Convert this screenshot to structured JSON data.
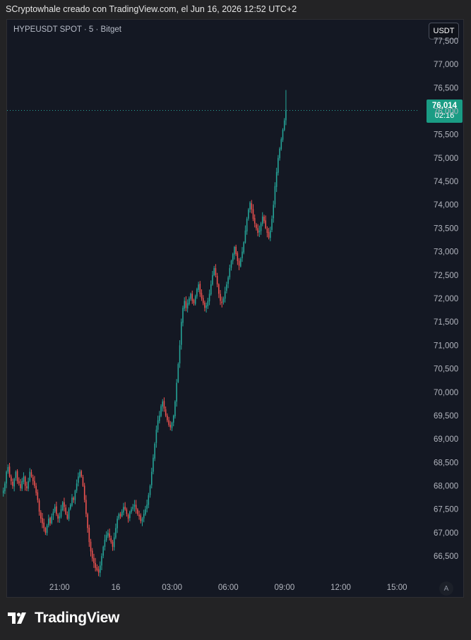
{
  "header": {
    "text": "SCryptowhale creado con TradingView.com, el Jun 16, 2026 12:52 UTC+2"
  },
  "legend": {
    "symbol": "HYPEUSDT SPOT · 5 · Bitget"
  },
  "currency_button": "USDT",
  "auto_button": "A",
  "last_price": {
    "price": "76,014",
    "countdown": "02:16"
  },
  "footer": {
    "logo_text": "TradingView"
  },
  "colors": {
    "up": "#26a69a",
    "down": "#ef5350",
    "background": "#141823",
    "price_tag": "#1a9c84"
  },
  "chart_data": {
    "type": "candlestick",
    "y_axis": {
      "position": "right",
      "ticks": [
        66500,
        67000,
        67500,
        68000,
        68500,
        69000,
        69500,
        70000,
        70500,
        71000,
        71500,
        72000,
        72500,
        73000,
        73500,
        74000,
        74500,
        75000,
        75500,
        76000,
        76500,
        77000,
        77500
      ],
      "tick_labels": [
        "66,500",
        "67,000",
        "67,500",
        "68,000",
        "68,500",
        "69,000",
        "69,500",
        "70,000",
        "70,500",
        "71,000",
        "71,500",
        "72,000",
        "72,500",
        "73,000",
        "73,500",
        "74,000",
        "74,500",
        "75,000",
        "75,500",
        "76,000",
        "76,500",
        "77,000",
        "77,500"
      ],
      "ylim": [
        66050,
        77950
      ]
    },
    "x_axis": {
      "ticks": [
        "21:00",
        "16",
        "03:00",
        "06:00",
        "09:00",
        "12:00",
        "15:00"
      ],
      "tick_hours": [
        21,
        24,
        27,
        30,
        33,
        36,
        39
      ],
      "xlim_hours": [
        18.2,
        40.2
      ]
    },
    "close_series": {
      "start_hour": 18.0,
      "interval_hours": 0.0833,
      "closes": [
        67900,
        68050,
        68300,
        68400,
        68200,
        68100,
        68000,
        68150,
        68300,
        68100,
        68050,
        67950,
        68100,
        68200,
        68000,
        67950,
        68100,
        68300,
        68200,
        68100,
        68000,
        67850,
        67700,
        67450,
        67300,
        67200,
        67100,
        67000,
        67150,
        67300,
        67200,
        67350,
        67450,
        67550,
        67400,
        67300,
        67350,
        67500,
        67650,
        67550,
        67400,
        67300,
        67500,
        67600,
        67750,
        67700,
        67900,
        68050,
        68200,
        68300,
        68200,
        68000,
        67700,
        67400,
        67100,
        66800,
        66600,
        66450,
        66350,
        66250,
        66200,
        66150,
        66300,
        66500,
        66700,
        66850,
        66950,
        67000,
        66900,
        66800,
        66700,
        66900,
        67100,
        67300,
        67400,
        67350,
        67450,
        67550,
        67500,
        67400,
        67300,
        67450,
        67500,
        67550,
        67600,
        67500,
        67400,
        67350,
        67250,
        67300,
        67400,
        67500,
        67600,
        67800,
        68000,
        68300,
        68600,
        68900,
        69200,
        69400,
        69500,
        69700,
        69800,
        69650,
        69500,
        69400,
        69300,
        69250,
        69350,
        69500,
        69800,
        70200,
        70600,
        71000,
        71500,
        71800,
        71950,
        71800,
        71900,
        72000,
        72100,
        71950,
        71900,
        72050,
        72200,
        72300,
        72100,
        72000,
        71900,
        71800,
        71850,
        71950,
        72100,
        72300,
        72500,
        72650,
        72500,
        72300,
        72100,
        71950,
        71900,
        72000,
        72150,
        72300,
        72450,
        72650,
        72800,
        72950,
        73100,
        72950,
        72800,
        72700,
        72850,
        73000,
        73200,
        73450,
        73700,
        73900,
        74050,
        73900,
        73700,
        73600,
        73500,
        73400,
        73450,
        73600,
        73750,
        73650,
        73500,
        73400,
        73300,
        73450,
        73700,
        74000,
        74400,
        74700,
        75000,
        75200,
        75400,
        75600,
        75800,
        76014
      ]
    }
  }
}
